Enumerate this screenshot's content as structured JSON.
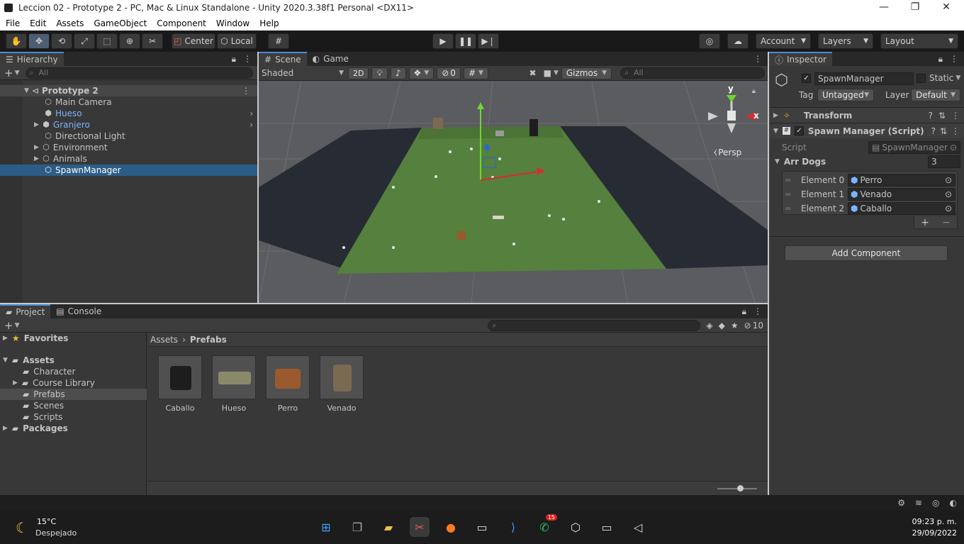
{
  "window": {
    "title": "Leccion 02 - Prototype 2 - PC, Mac & Linux Standalone - Unity 2020.3.38f1 Personal <DX11>",
    "controls": [
      "—",
      "❐",
      "✕"
    ]
  },
  "menu": [
    "File",
    "Edit",
    "Assets",
    "GameObject",
    "Component",
    "Window",
    "Help"
  ],
  "toolbar": {
    "pivot_label": "Center",
    "space_label": "Local",
    "account_label": "Account",
    "layers_label": "Layers",
    "layout_label": "Layout"
  },
  "hierarchy": {
    "tab": "Hierarchy",
    "search_placeholder": "All",
    "scene": "Prototype 2",
    "items": [
      {
        "label": "Main Camera",
        "prefab": false,
        "foldout": false,
        "arrow": false
      },
      {
        "label": "Hueso",
        "prefab": true,
        "foldout": false,
        "arrow": true
      },
      {
        "label": "Granjero",
        "prefab": true,
        "foldout": true,
        "arrow": true
      },
      {
        "label": "Directional Light",
        "prefab": false,
        "foldout": false,
        "arrow": false
      },
      {
        "label": "Environment",
        "prefab": false,
        "foldout": true,
        "arrow": false
      },
      {
        "label": "Animals",
        "prefab": false,
        "foldout": true,
        "arrow": false
      },
      {
        "label": "SpawnManager",
        "prefab": false,
        "foldout": false,
        "arrow": false,
        "selected": true
      }
    ]
  },
  "scene_view": {
    "tabs": [
      "Scene",
      "Game"
    ],
    "shading": "Shaded",
    "mode_2d": "2D",
    "hidden_count": "0",
    "gizmos_label": "Gizmos",
    "search_placeholder": "All",
    "persp_label": "Persp",
    "axes": {
      "y": "y",
      "x": "x"
    }
  },
  "inspector": {
    "tab": "Inspector",
    "object_name": "SpawnManager",
    "static_label": "Static",
    "tag_label": "Tag",
    "tag_value": "Untagged",
    "layer_label": "Layer",
    "layer_value": "Default",
    "transform_label": "Transform",
    "component_label": "Spawn Manager (Script)",
    "script_label": "Script",
    "script_value": "SpawnManager",
    "array_label": "Arr Dogs",
    "array_size": "3",
    "elements": [
      {
        "label": "Element 0",
        "value": "Perro"
      },
      {
        "label": "Element 1",
        "value": "Venado"
      },
      {
        "label": "Element 2",
        "value": "Caballo"
      }
    ],
    "plus": "+",
    "minus": "−",
    "add_component": "Add Component"
  },
  "project": {
    "tabs": [
      "Project",
      "Console"
    ],
    "hidden_count": "10",
    "tree": [
      {
        "label": "Favorites",
        "level": 0,
        "type": "star",
        "bold": true,
        "foldout": true
      },
      {
        "label": "Assets",
        "level": 0,
        "type": "folder",
        "bold": true,
        "foldout": true,
        "open": true
      },
      {
        "label": "Character",
        "level": 1,
        "type": "folder",
        "bold": false,
        "foldout": false
      },
      {
        "label": "Course Library",
        "level": 1,
        "type": "folder",
        "bold": false,
        "foldout": true
      },
      {
        "label": "Prefabs",
        "level": 1,
        "type": "folder",
        "bold": false,
        "foldout": false,
        "selected": true
      },
      {
        "label": "Scenes",
        "level": 1,
        "type": "folder",
        "bold": false,
        "foldout": false
      },
      {
        "label": "Scripts",
        "level": 1,
        "type": "folder",
        "bold": false,
        "foldout": false
      },
      {
        "label": "Packages",
        "level": 0,
        "type": "folder",
        "bold": true,
        "foldout": true
      }
    ],
    "breadcrumb": [
      "Assets",
      "Prefabs"
    ],
    "assets": [
      {
        "label": "Caballo",
        "color": "#1d1d1d"
      },
      {
        "label": "Hueso",
        "color": "#8a8a6a"
      },
      {
        "label": "Perro",
        "color": "#9a5a2e"
      },
      {
        "label": "Venado",
        "color": "#7a6a52"
      }
    ]
  },
  "taskbar": {
    "weather_temp": "15°C",
    "weather_desc": "Despejado",
    "time": "09:23 p. m.",
    "date": "29/09/2022",
    "whatsapp_badge": "15"
  },
  "colors": {
    "selection": "#2c5d87",
    "accent": "#4a8bd4",
    "prefab_text": "#7ab6ff",
    "panel_bg": "#383838"
  }
}
